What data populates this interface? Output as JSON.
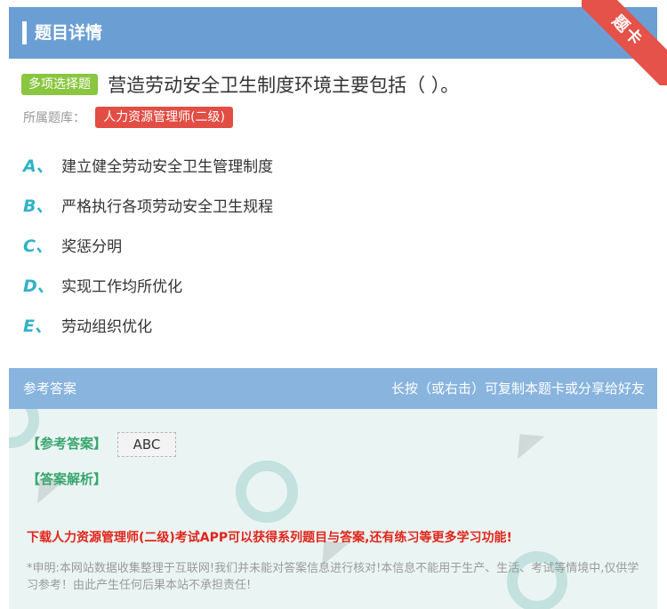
{
  "header": {
    "title": "题目详情",
    "ribbon_label": "题卡"
  },
  "question": {
    "type_label": "多项选择题",
    "text": "营造劳动安全卫生制度环境主要包括（ ）。",
    "bank_label": "所属题库：",
    "bank_name": "人力资源管理师(二级)"
  },
  "options": [
    {
      "letter": "A、",
      "text": "建立健全劳动安全卫生管理制度"
    },
    {
      "letter": "B、",
      "text": "严格执行各项劳动安全卫生规程"
    },
    {
      "letter": "C、",
      "text": "奖惩分明"
    },
    {
      "letter": "D、",
      "text": "实现工作均所优化"
    },
    {
      "letter": "E、",
      "text": "劳动组织优化"
    }
  ],
  "answer_section": {
    "title": "参考答案",
    "hint": "长按（或右击）可复制本题卡或分享给好友",
    "answer_label": "【参考答案】",
    "answer_value": "ABC",
    "analysis_label": "【答案解析】",
    "promo_text": "下载人力资源管理师(二级)考试APP可以获得系列题目与答案,还有练习等更多学习功能!",
    "disclaimer": "*申明:本网站数据收集整理于互联网!我们并未能对答案信息进行核对!本信息不能用于生产、生活、考试等情境中,仅供学习参考！由此产生任何后果本站不承担责任!"
  },
  "colors": {
    "header_bg": "#6b9fd4",
    "ribbon": "#e45249",
    "type_badge": "#8ac640",
    "bank_tag": "#e24d44",
    "option_letter": "#2fb3c7",
    "answer_label": "#3aa56f",
    "promo": "#e0251b"
  }
}
